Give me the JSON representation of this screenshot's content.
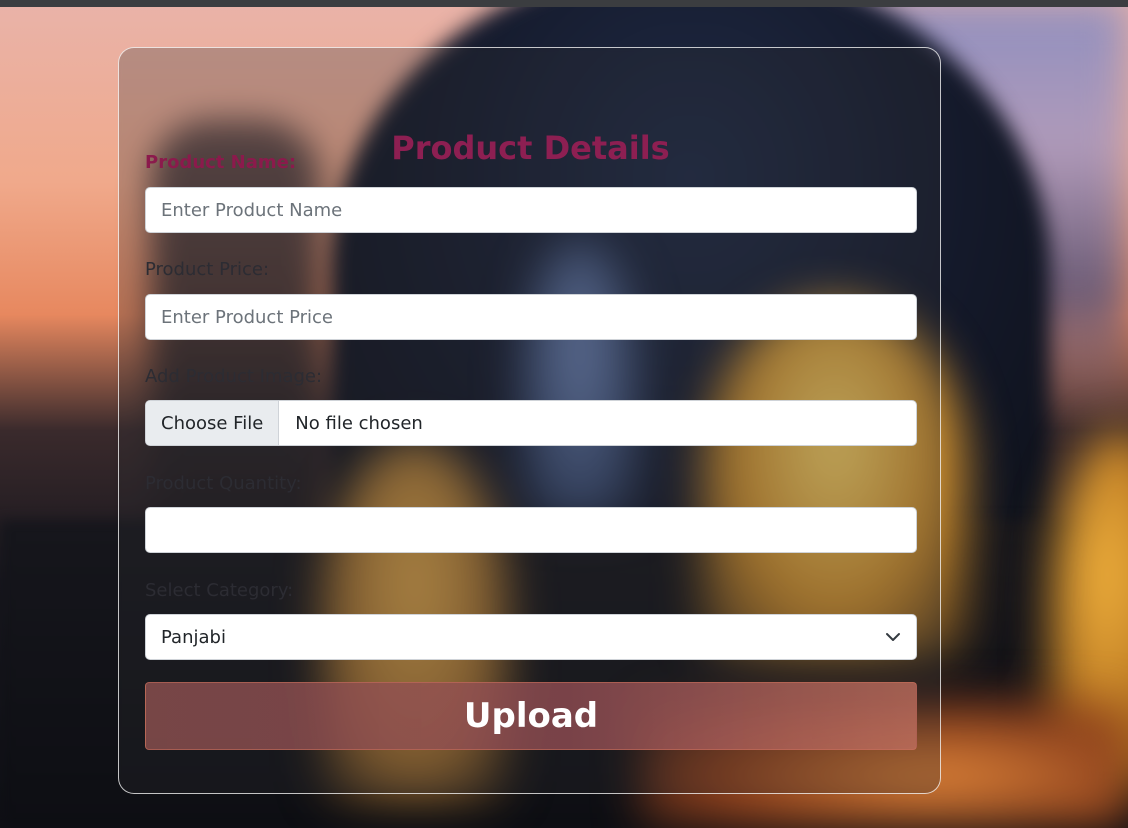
{
  "form": {
    "title": "Product Details",
    "fields": {
      "name": {
        "label": "Product Name:",
        "value": "",
        "placeholder": "Enter Product Name"
      },
      "price": {
        "label": "Product Price:",
        "value": "",
        "placeholder": "Enter Product Price"
      },
      "image": {
        "label": "Add Product Image:",
        "button_label": "Choose File",
        "status_text": "No file chosen"
      },
      "quantity": {
        "label": "Product Quantity:",
        "value": "",
        "placeholder": ""
      },
      "category": {
        "label": "Select Category:",
        "selected": "Panjabi"
      }
    },
    "submit_label": "Upload"
  },
  "colors": {
    "title": "#8d1f52",
    "accent_label": "#8b1a4c",
    "upload_button": "#96555a"
  },
  "icons": {
    "select_arrow": "chevron-down-icon"
  }
}
